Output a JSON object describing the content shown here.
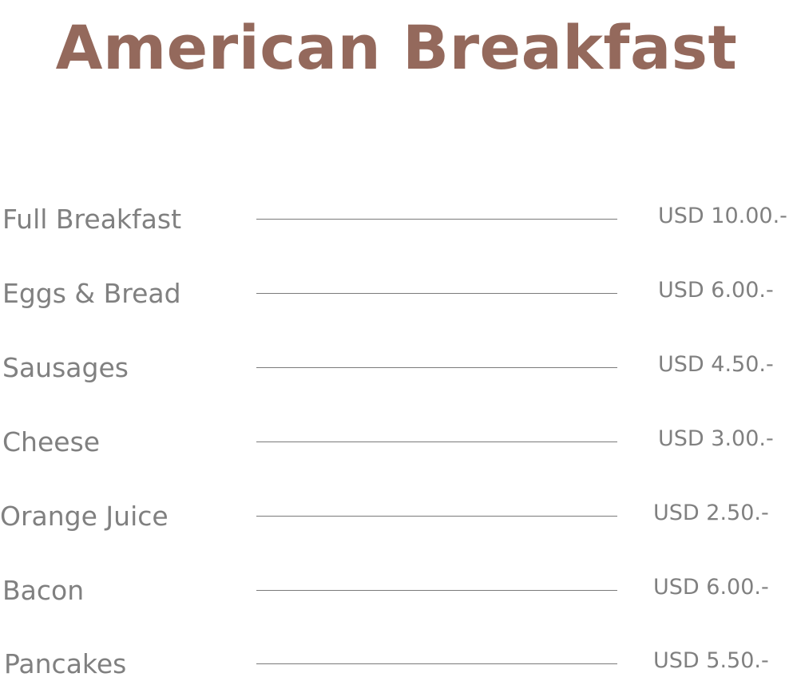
{
  "colors": {
    "title": "#94695c",
    "text": "#808080",
    "rule": "#7a7a7a"
  },
  "menu": {
    "title": "American Breakfast",
    "items": [
      {
        "name": "Full Breakfast",
        "price": "USD 10.00.-"
      },
      {
        "name": "Eggs & Bread",
        "price": "USD 6.00.-"
      },
      {
        "name": "Sausages",
        "price": "USD 4.50.-"
      },
      {
        "name": "Cheese",
        "price": "USD 3.00.-"
      },
      {
        "name": "Orange Juice",
        "price": "USD 2.50.-"
      },
      {
        "name": "Bacon",
        "price": "USD 6.00.-"
      },
      {
        "name": "Pancakes",
        "price": "USD 5.50.-"
      }
    ]
  }
}
